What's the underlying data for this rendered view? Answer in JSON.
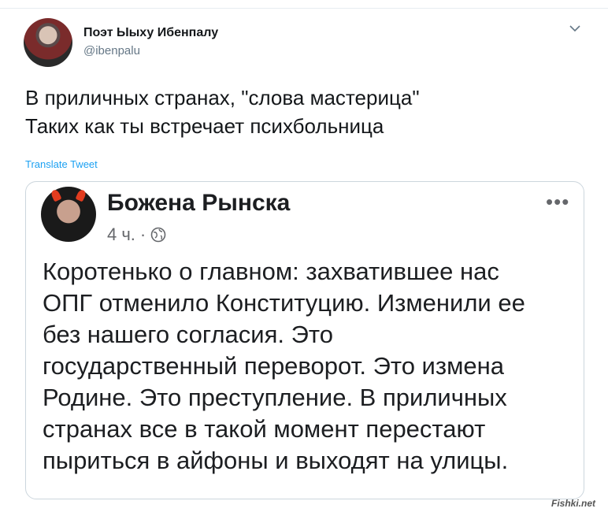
{
  "tweet": {
    "author_name": "Поэт Ыыху Ибенпалу",
    "author_handle": "@ibenpalu",
    "caret_icon": "chevron-down-icon",
    "text_lines": [
      "В приличных странах, \"слова мастерица\"",
      "Таких как ты встречает психбольница"
    ],
    "translate_label": "Translate Tweet"
  },
  "embedded_post": {
    "author_name": "Божена Рынска",
    "time": "4 ч.",
    "separator": "·",
    "privacy_icon": "globe-icon",
    "more_icon": "•••",
    "text_lines": [
      "Коротенько о главном: захватившее нас",
      "ОПГ отменило Конституцию. Изменили ее",
      "без нашего согласия. Это",
      "государственный переворот. Это измена",
      "Родине. Это преступление. В приличных",
      "странах все в такой момент перестают",
      "пыриться в айфоны и выходят на улицы."
    ]
  },
  "watermark": "Fishki.net",
  "colors": {
    "link": "#1da1f2",
    "handle": "#657786",
    "border": "#ccd6dd",
    "fb_meta": "#65676b"
  }
}
